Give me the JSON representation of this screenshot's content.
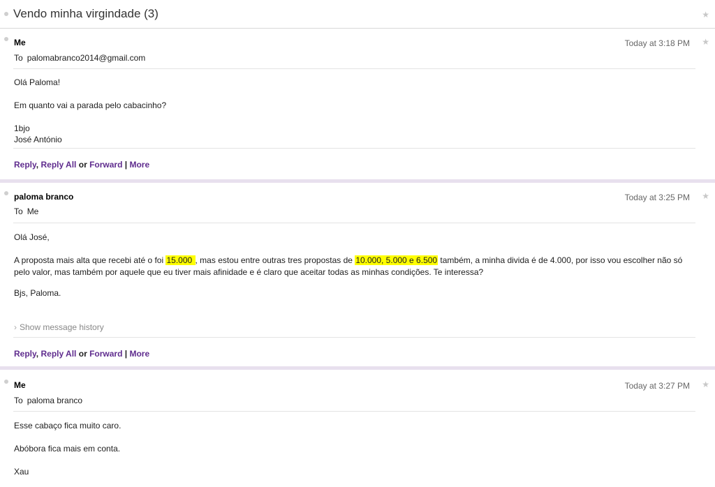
{
  "subject": "Vendo minha virgindade (3)",
  "messages": [
    {
      "sender": "Me",
      "time": "Today at 3:18 PM",
      "to_label": "To",
      "to": "palomabranco2014@gmail.com",
      "body": [
        "Olá Paloma!",
        "Em quanto vai a parada pelo cabacinho?",
        "1bjo",
        "José António"
      ]
    },
    {
      "sender": "paloma branco",
      "time": "Today at 3:25 PM",
      "to_label": "To",
      "to": "Me",
      "greeting": "Olá José,",
      "p1_a": "A proposta mais alta que recebi até o foi ",
      "p1_hl1": "15.000 ",
      "p1_b": ", mas estou entre outras tres propostas de ",
      "p1_hl2": "10.000, 5.000 e 6.500",
      "p1_c": " também, a minha divida é de 4.000, por isso vou escolher não só pelo valor, mas também por aquele que eu tiver mais afinidade e é claro que aceitar todas as minhas condições. Te interessa?",
      "sign": "Bjs, Paloma.",
      "history": "Show message history"
    },
    {
      "sender": "Me",
      "time": "Today at 3:27 PM",
      "to_label": "To",
      "to": "paloma branco",
      "body": [
        "Esse cabaço fica muito caro.",
        "Abóbora fica mais em conta.",
        "Xau"
      ]
    }
  ],
  "actions": {
    "reply": "Reply",
    "comma": ",",
    "reply_all": "Reply All",
    "or": "or",
    "forward": "Forward",
    "pipe": "|",
    "more": "More"
  },
  "icons": {
    "star": "star-icon",
    "chevron": "chevron-right-icon"
  }
}
